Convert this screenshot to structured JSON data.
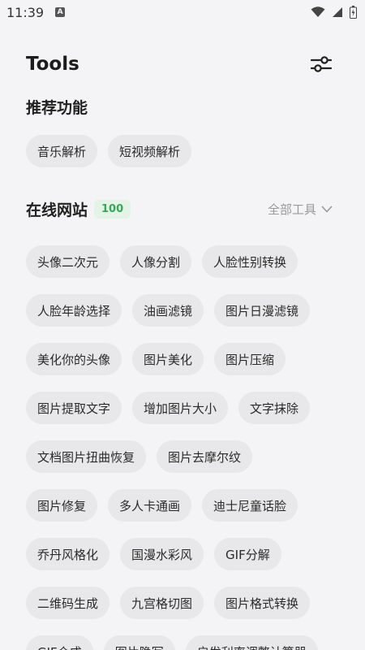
{
  "status": {
    "time": "11:39",
    "notif_letter": "A"
  },
  "header": {
    "title": "Tools",
    "settings_icon": "sliders-icon"
  },
  "recommended": {
    "title": "推荐功能",
    "items": [
      "音乐解析",
      "短视频解析"
    ]
  },
  "online": {
    "title": "在线网站",
    "count": "100",
    "all_tools_label": "全部工具",
    "rows": [
      [
        "头像二次元",
        "人像分割",
        "人脸性别转换"
      ],
      [
        "人脸年龄选择",
        "油画滤镜",
        "图片日漫滤镜"
      ],
      [
        "美化你的头像",
        "图片美化",
        "图片压缩"
      ],
      [
        "图片提取文字",
        "增加图片大小",
        "文字抹除"
      ],
      [
        "文档图片扭曲恢复",
        "图片去摩尔纹"
      ],
      [
        "图片修复",
        "多人卡通画",
        "迪士尼童话脸"
      ],
      [
        "乔丹风格化",
        "国漫水彩风",
        "GIF分解"
      ],
      [
        "二维码生成",
        "九宫格切图",
        "图片格式转换"
      ],
      [
        "GIF合成",
        "图片隐写",
        "启发利率调整计算器"
      ]
    ]
  },
  "colors": {
    "background": "#f4f4f6",
    "chip": "#e8e8ea",
    "badge_bg": "#e3f3e6",
    "badge_text": "#3aa55a"
  }
}
